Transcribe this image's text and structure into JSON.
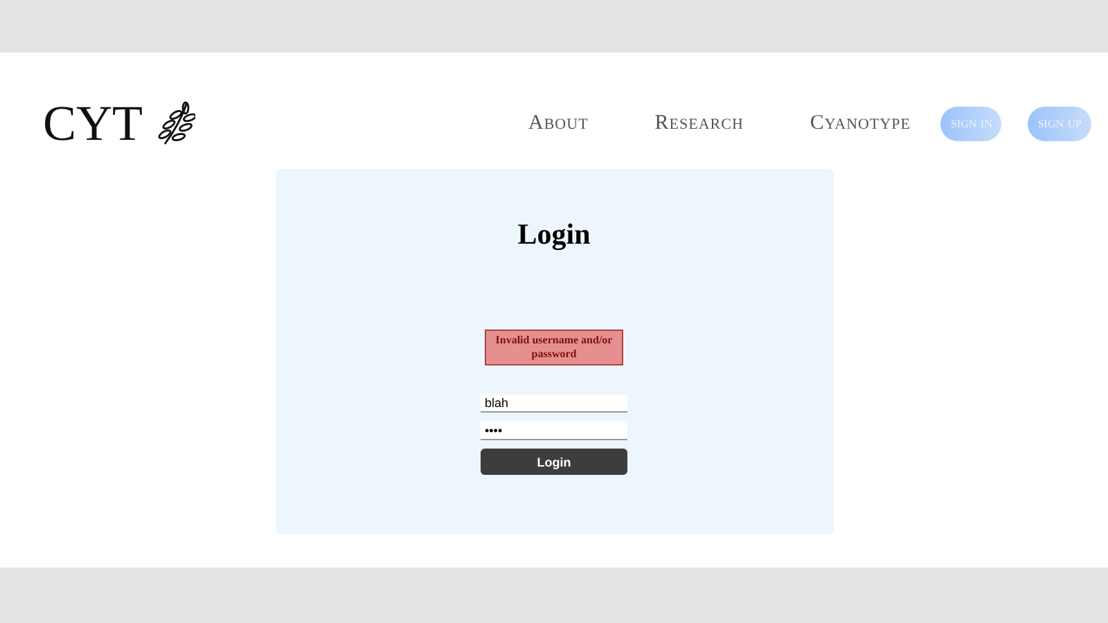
{
  "logo": {
    "text": "CYT"
  },
  "nav": [
    {
      "label": "About"
    },
    {
      "label": "Research"
    },
    {
      "label": "Cyanotype"
    }
  ],
  "auth_buttons": [
    "sign in",
    "sign up"
  ],
  "login": {
    "title": "Login",
    "error": "Invalid username and/or password",
    "username": "blah",
    "password": "••••",
    "button": "Login"
  }
}
